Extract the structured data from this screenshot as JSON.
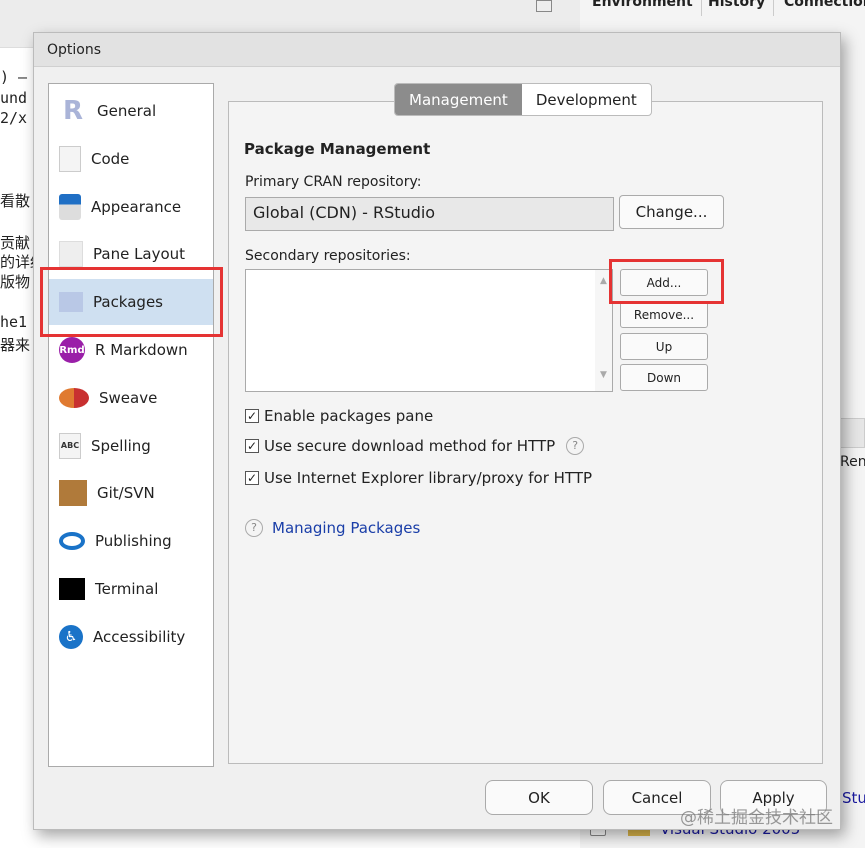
{
  "background": {
    "code_lines": [
      ") –",
      "und",
      "2/x",
      "看散",
      "贡献",
      "的详细",
      "版物",
      "he1",
      "器来"
    ],
    "right_tabs": [
      "Environment",
      "History",
      "Connections"
    ],
    "right_text": [
      "Ren",
      "Stu"
    ],
    "folder_item": "Visual Studio 2005"
  },
  "dialog": {
    "title": "Options",
    "sidebar": [
      {
        "label": "General",
        "icon": "r-logo-icon"
      },
      {
        "label": "Code",
        "icon": "code-icon"
      },
      {
        "label": "Appearance",
        "icon": "paint-bucket-icon"
      },
      {
        "label": "Pane Layout",
        "icon": "pane-layout-icon"
      },
      {
        "label": "Packages",
        "icon": "package-icon",
        "selected": true
      },
      {
        "label": "R Markdown",
        "icon": "rmd-icon",
        "icon_text": "Rmd"
      },
      {
        "label": "Sweave",
        "icon": "sweave-icon"
      },
      {
        "label": "Spelling",
        "icon": "spelling-icon",
        "icon_text": "ABC"
      },
      {
        "label": "Git/SVN",
        "icon": "git-box-icon"
      },
      {
        "label": "Publishing",
        "icon": "publishing-icon"
      },
      {
        "label": "Terminal",
        "icon": "terminal-icon"
      },
      {
        "label": "Accessibility",
        "icon": "accessibility-icon"
      }
    ],
    "tabs": [
      "Management",
      "Development"
    ],
    "active_tab": "Management",
    "section_title": "Package Management",
    "primary_label": "Primary CRAN repository:",
    "primary_value": "Global (CDN) - RStudio",
    "change_button": "Change...",
    "secondary_label": "Secondary repositories:",
    "secondary_buttons": [
      "Add...",
      "Remove...",
      "Up",
      "Down"
    ],
    "checkboxes": [
      {
        "label": "Enable packages pane",
        "checked": true
      },
      {
        "label": "Use secure download method for HTTP",
        "checked": true,
        "help": true
      },
      {
        "label": "Use Internet Explorer library/proxy for HTTP",
        "checked": true
      }
    ],
    "help_link": "Managing Packages",
    "footer_buttons": [
      "OK",
      "Cancel",
      "Apply"
    ]
  },
  "watermark": "@稀土掘金技术社区",
  "colors": {
    "highlight": "#e53333",
    "selected": "#cfe0f1",
    "link": "#1a3ea8"
  }
}
